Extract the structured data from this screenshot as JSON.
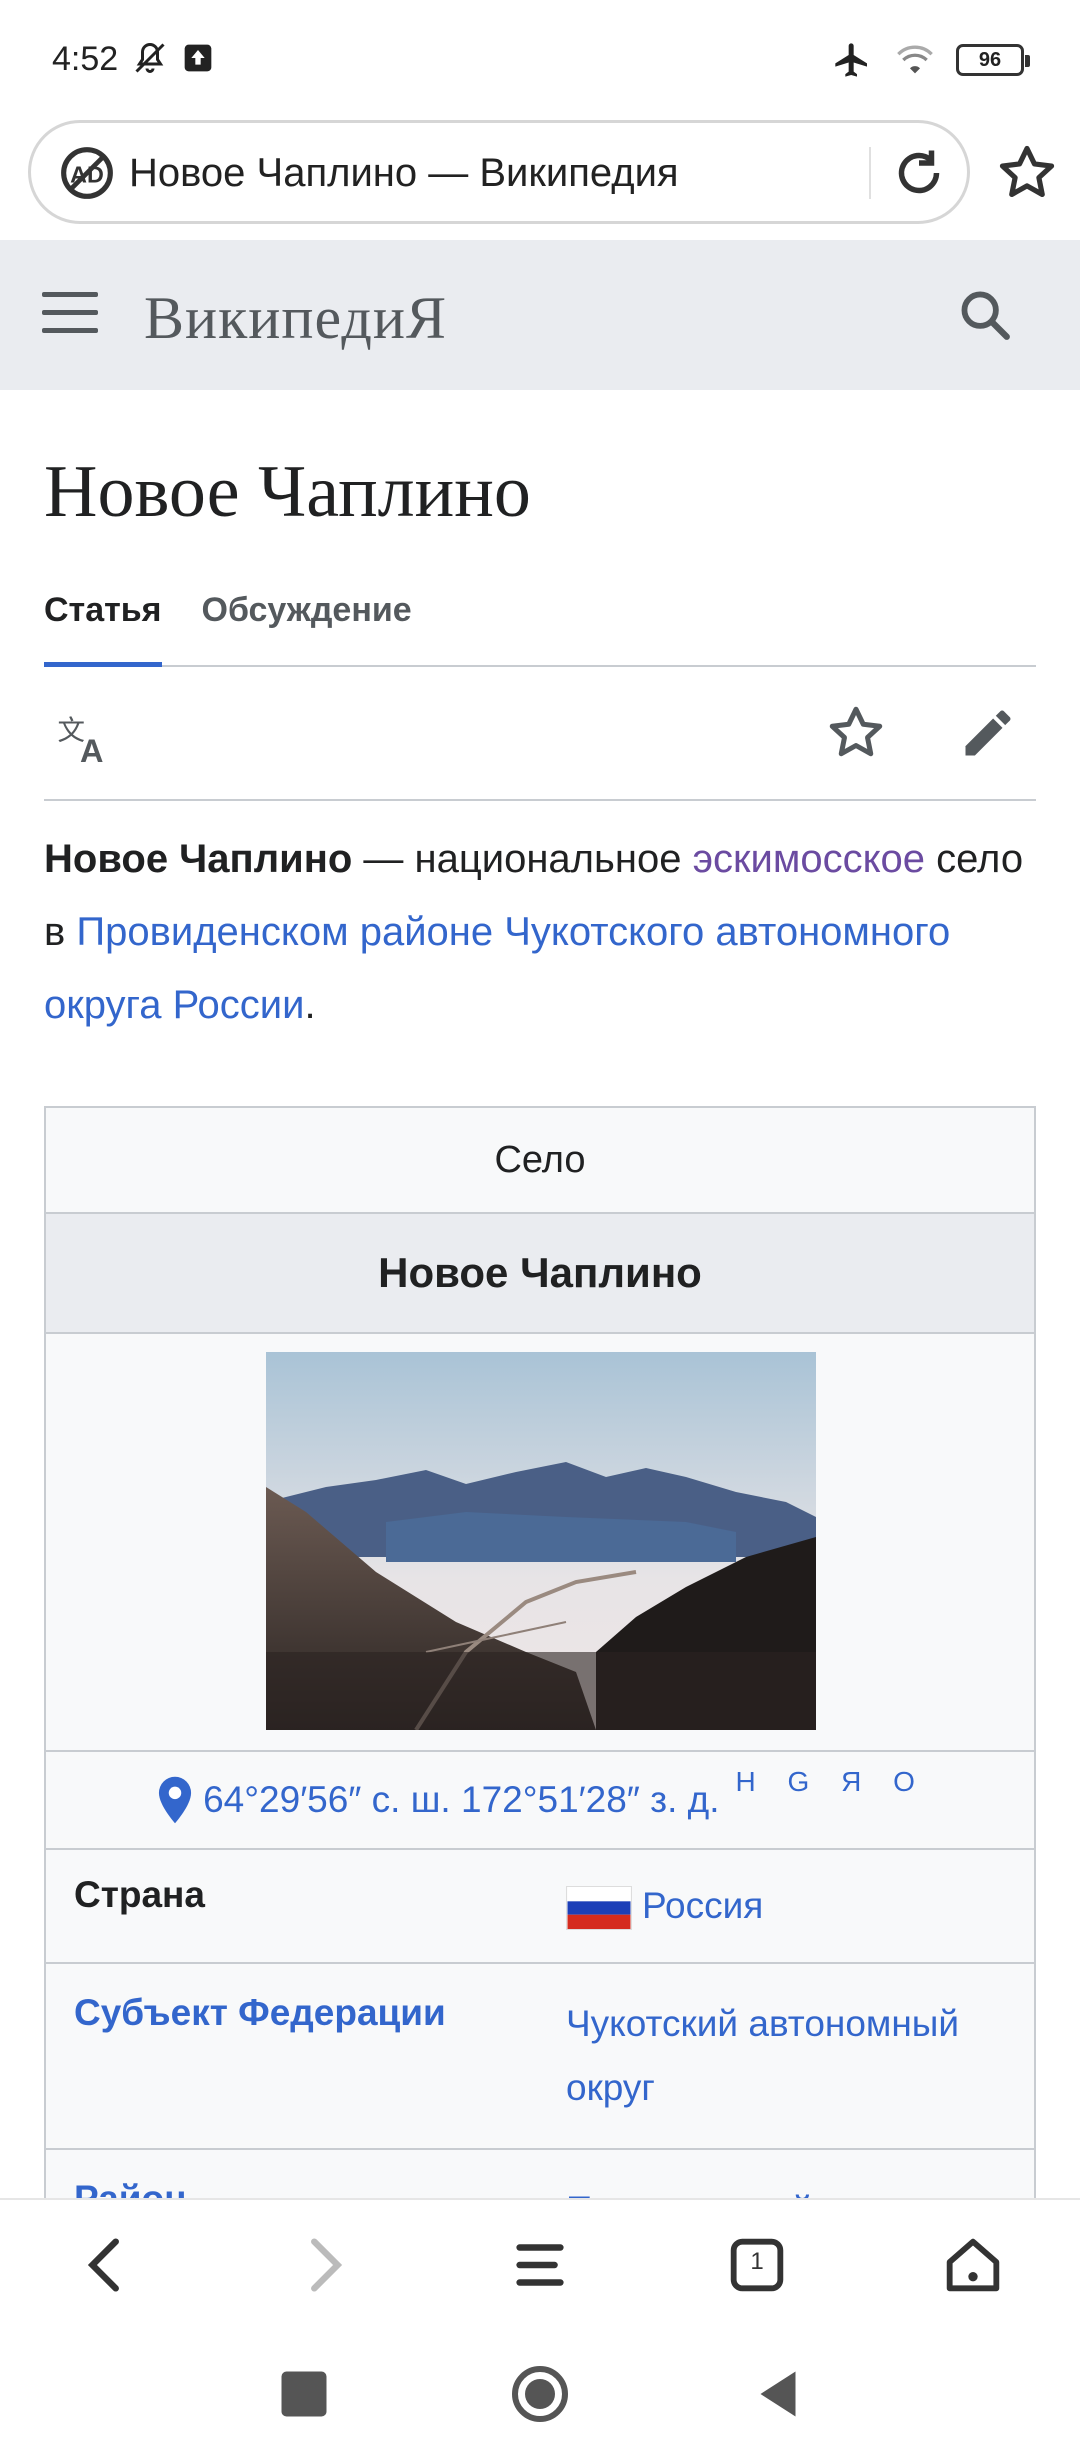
{
  "status_bar": {
    "time": "4:52",
    "battery": "96"
  },
  "address_bar": {
    "title": "Новое Чаплино — Википедия"
  },
  "header": {
    "wordmark_main": "Википеди",
    "wordmark_end": "Я"
  },
  "article": {
    "title": "Новое Чаплино",
    "tabs": [
      {
        "label": "Статья",
        "active": true
      },
      {
        "label": "Обсуждение",
        "active": false
      }
    ],
    "lead": {
      "bold": "Новое Чаплино",
      "t1": " — национальное ",
      "link1": "эскимосское",
      "t2": " село в ",
      "link2": "Провиденском районе Чукотского автономного округа России",
      "t3": "."
    }
  },
  "infobox": {
    "type": "Село",
    "name": "Новое Чаплино",
    "coords": "64°29′56″ с. ш. 172°51′28″ з. д.",
    "coords_links": "H G Я O",
    "rows": [
      {
        "label": "Страна",
        "value": "Россия",
        "label_link": false
      },
      {
        "label": "Субъект Федерации",
        "value": "Чукотский автономный округ",
        "label_link": true
      },
      {
        "label": "Район",
        "value": "Провиденский",
        "label_link": true
      }
    ]
  },
  "bottom_nav": {
    "tabs_count": "1"
  }
}
